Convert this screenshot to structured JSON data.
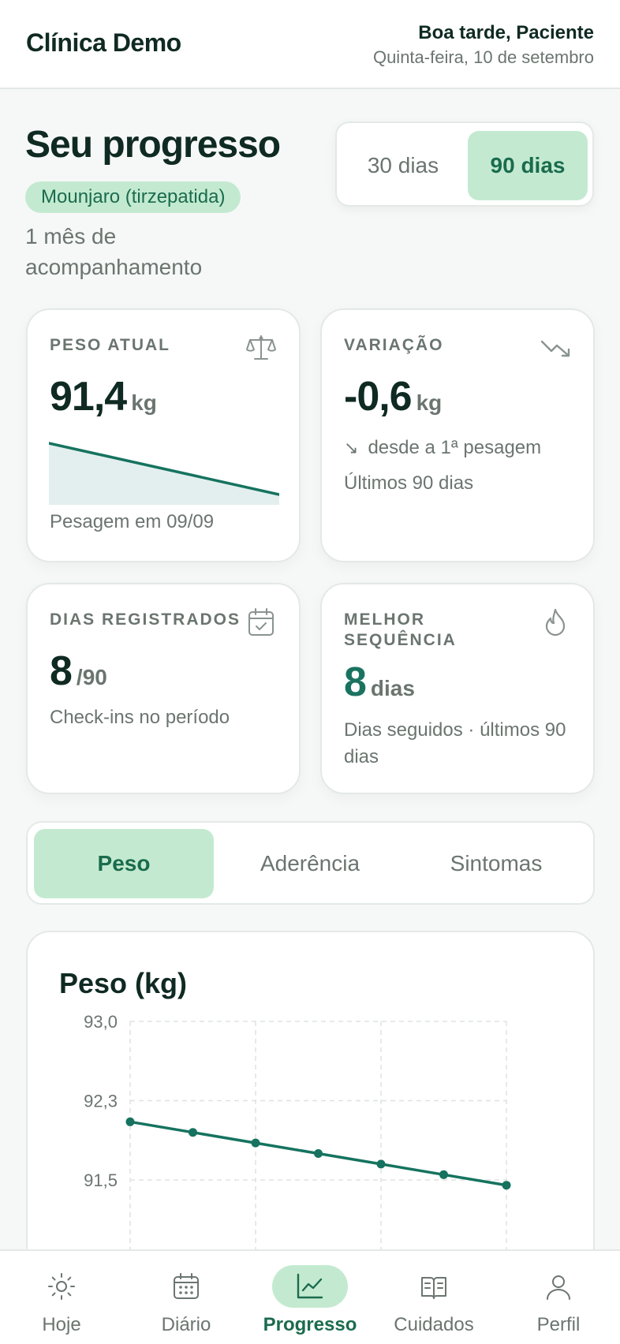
{
  "header": {
    "brand": "Clínica Demo",
    "greeting": "Boa tarde, Paciente",
    "date": "Quinta-feira, 10 de setembro"
  },
  "page": {
    "title": "Seu progresso",
    "medication": "Mounjaro (tirzepatida)",
    "followup": "1 mês de acompanhamento"
  },
  "period": {
    "options": [
      "30 dias",
      "90 dias"
    ],
    "selected": "90 dias"
  },
  "cards": {
    "weight": {
      "label": "PESO ATUAL",
      "icon": "scale-icon",
      "value": "91,4",
      "unit": "kg",
      "note": "Pesagem em 09/09"
    },
    "change": {
      "label": "VARIAÇÃO",
      "icon": "trending-down-icon",
      "value": "-0,6",
      "unit": "kg",
      "since": "desde a 1ª pesagem",
      "period": "Últimos 90 dias"
    },
    "days": {
      "label": "DIAS REGISTRADOS",
      "icon": "calendar-check-icon",
      "value": "8",
      "total": "/90",
      "note": "Check-ins no período"
    },
    "streak": {
      "label": "MELHOR SEQUÊNCIA",
      "icon": "flame-icon",
      "value": "8",
      "unit": "dias",
      "note": "Dias seguidos · últimos 90 dias"
    }
  },
  "tabs": {
    "items": [
      "Peso",
      "Aderência",
      "Sintomas"
    ],
    "selected": "Peso"
  },
  "chart_data": {
    "type": "line",
    "title": "Peso (kg)",
    "yticks": [
      "93,0",
      "92,3",
      "91,5"
    ],
    "ylim": [
      91.5,
      93.0
    ],
    "x": [
      1,
      2,
      3,
      4,
      5,
      6,
      7
    ],
    "series": [
      {
        "values": [
          92.05,
          91.95,
          91.85,
          91.75,
          91.65,
          91.55,
          91.45
        ]
      }
    ],
    "grid": true,
    "colors": {
      "line": "#15735f"
    }
  },
  "nav": {
    "items": [
      {
        "label": "Hoje",
        "icon": "sun-icon"
      },
      {
        "label": "Diário",
        "icon": "calendar-icon"
      },
      {
        "label": "Progresso",
        "icon": "chart-icon"
      },
      {
        "label": "Cuidados",
        "icon": "book-icon"
      },
      {
        "label": "Perfil",
        "icon": "user-icon"
      }
    ],
    "active": "Progresso"
  },
  "colors": {
    "accent": "#1a7360",
    "accent_bg": "#c3ead0",
    "text": "#0f2a22",
    "muted": "#6b7570"
  }
}
